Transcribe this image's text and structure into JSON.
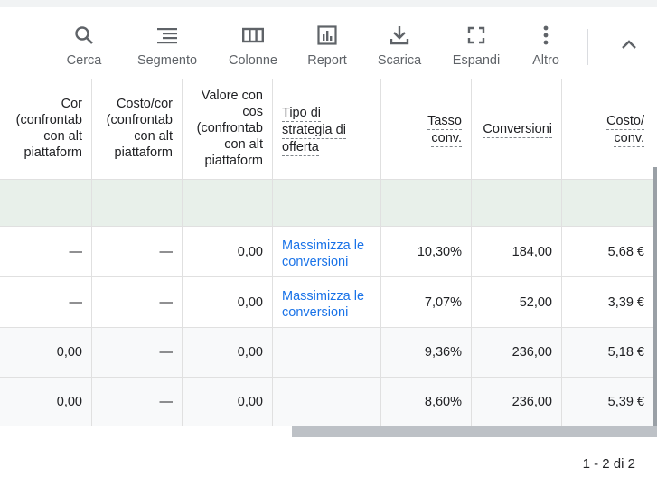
{
  "toolbar": {
    "items": [
      {
        "label": "Cerca",
        "icon": "search-icon"
      },
      {
        "label": "Segmento",
        "icon": "segment-icon"
      },
      {
        "label": "Colonne",
        "icon": "columns-icon"
      },
      {
        "label": "Report",
        "icon": "report-icon"
      },
      {
        "label": "Scarica",
        "icon": "download-icon"
      },
      {
        "label": "Espandi",
        "icon": "expand-icon"
      },
      {
        "label": "Altro",
        "icon": "more-vert-icon"
      }
    ],
    "collapse_icon": "chevron-up-icon"
  },
  "table": {
    "headers": [
      {
        "lines": [
          "Cor",
          "(confrontab",
          "con alt",
          "piattaform"
        ]
      },
      {
        "lines": [
          "Costo/cor",
          "(confrontab",
          "con alt",
          "piattaform"
        ]
      },
      {
        "lines": [
          "Valore con",
          "cos",
          "(confrontab",
          "con alt",
          "piattaform"
        ]
      },
      {
        "lines": [
          "Tipo di",
          "strategia di",
          "offerta"
        ]
      },
      {
        "lines": [
          "Tasso",
          "conv."
        ]
      },
      {
        "lines": [
          "Conversioni"
        ]
      },
      {
        "lines": [
          "Costo/",
          "conv."
        ]
      }
    ],
    "rows": [
      {
        "type": "total",
        "cells": [
          "",
          "",
          "",
          "",
          "",
          "",
          ""
        ]
      },
      {
        "type": "data",
        "cells": [
          "—",
          "—",
          "0,00",
          "Massimizza le conversioni",
          "10,30%",
          "184,00",
          "5,68 €"
        ]
      },
      {
        "type": "data",
        "cells": [
          "—",
          "—",
          "0,00",
          "Massimizza le conversioni",
          "7,07%",
          "52,00",
          "3,39 €"
        ]
      },
      {
        "type": "gray",
        "cells": [
          "0,00",
          "—",
          "0,00",
          "",
          "9,36%",
          "236,00",
          "5,18 €"
        ]
      },
      {
        "type": "gray",
        "cells": [
          "0,00",
          "—",
          "0,00",
          "",
          "8,60%",
          "236,00",
          "5,39 €"
        ]
      }
    ]
  },
  "pagination": "1 - 2 di 2",
  "colors": {
    "link": "#1a73e8",
    "total_row_bg": "#e8f0ea",
    "icon": "#5f6368"
  }
}
